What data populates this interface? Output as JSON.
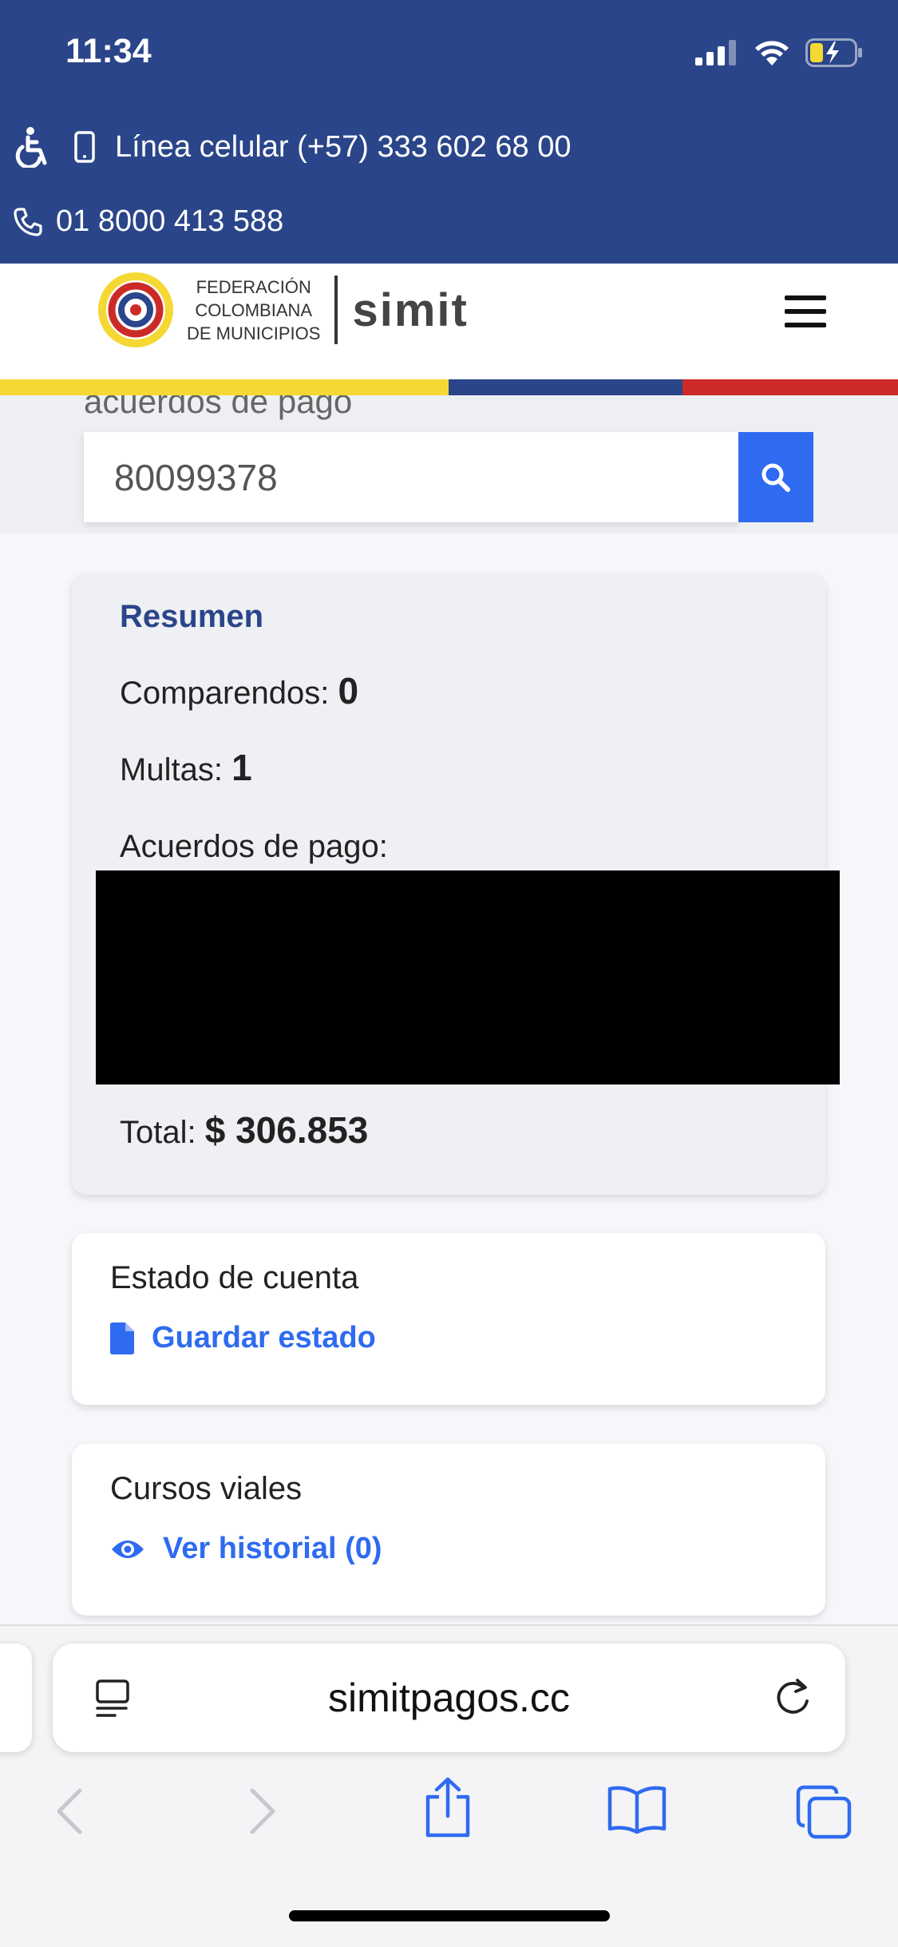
{
  "status": {
    "time": "11:34"
  },
  "topinfo": {
    "cell_line": "Línea celular (+57) 333 602 68 00",
    "phone": "01 8000 413 588"
  },
  "logo": {
    "fed_line1": "FEDERACIÓN",
    "fed_line2": "COLOMBIANA",
    "fed_line3": "DE MUNICIPIOS",
    "brand": "simit"
  },
  "stripe_colors": {
    "yellow": "#f5d833",
    "blue": "#2a4589",
    "red": "#cc2a28"
  },
  "search": {
    "label": "acuerdos de pago",
    "value": "80099378"
  },
  "summary": {
    "title": "Resumen",
    "comparendos_label": "Comparendos:",
    "comparendos_value": "0",
    "multas_label": "Multas:",
    "multas_value": "1",
    "acuerdos_label": "Acuerdos de pago:",
    "total_label": "Total:",
    "total_value": "$ 306.853"
  },
  "estado": {
    "title": "Estado de cuenta",
    "link": "Guardar estado"
  },
  "cursos": {
    "title": "Cursos viales",
    "link": "Ver historial (0)"
  },
  "browser": {
    "url": "simitpagos.cc"
  },
  "colors": {
    "accent": "#2f6bf0",
    "navy": "#2a4589"
  }
}
